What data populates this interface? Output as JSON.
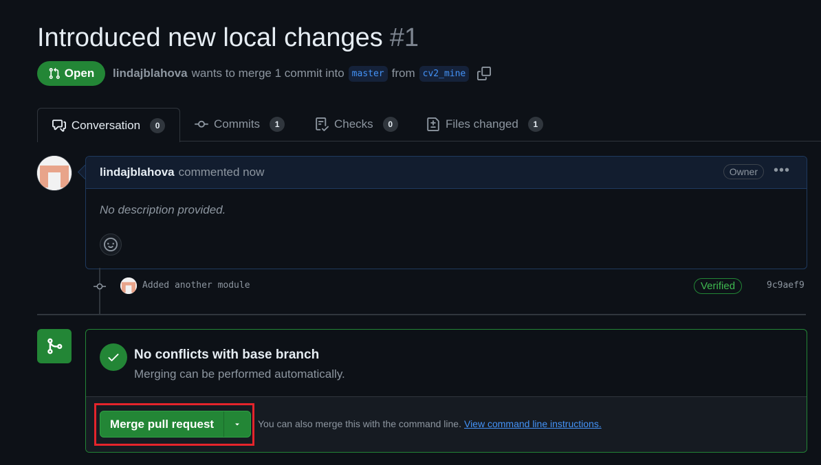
{
  "pr": {
    "title": "Introduced new local changes",
    "number": "#1",
    "state": "Open",
    "author": "lindajblahova",
    "merge_text_1": "wants to merge 1 commit into",
    "base_branch": "master",
    "merge_text_2": "from",
    "head_branch": "cv2_mine"
  },
  "tabs": [
    {
      "label": "Conversation",
      "count": "0",
      "icon": "comment-discussion-icon"
    },
    {
      "label": "Commits",
      "count": "1",
      "icon": "git-commit-icon"
    },
    {
      "label": "Checks",
      "count": "0",
      "icon": "checklist-icon"
    },
    {
      "label": "Files changed",
      "count": "1",
      "icon": "file-diff-icon"
    }
  ],
  "comment": {
    "author": "lindajblahova",
    "time": "commented now",
    "role": "Owner",
    "body": "No description provided."
  },
  "commit": {
    "message": "Added another module",
    "verified": "Verified",
    "sha": "9c9aef9"
  },
  "merge": {
    "heading": "No conflicts with base branch",
    "subheading": "Merging can be performed automatically.",
    "button": "Merge pull request",
    "cli_text": "You can also merge this with the command line.",
    "cli_link": "View command line instructions."
  },
  "colors": {
    "bg": "#0d1117",
    "accent_green": "#238636",
    "link_blue": "#4493f8",
    "highlight_red": "#e5242b"
  }
}
